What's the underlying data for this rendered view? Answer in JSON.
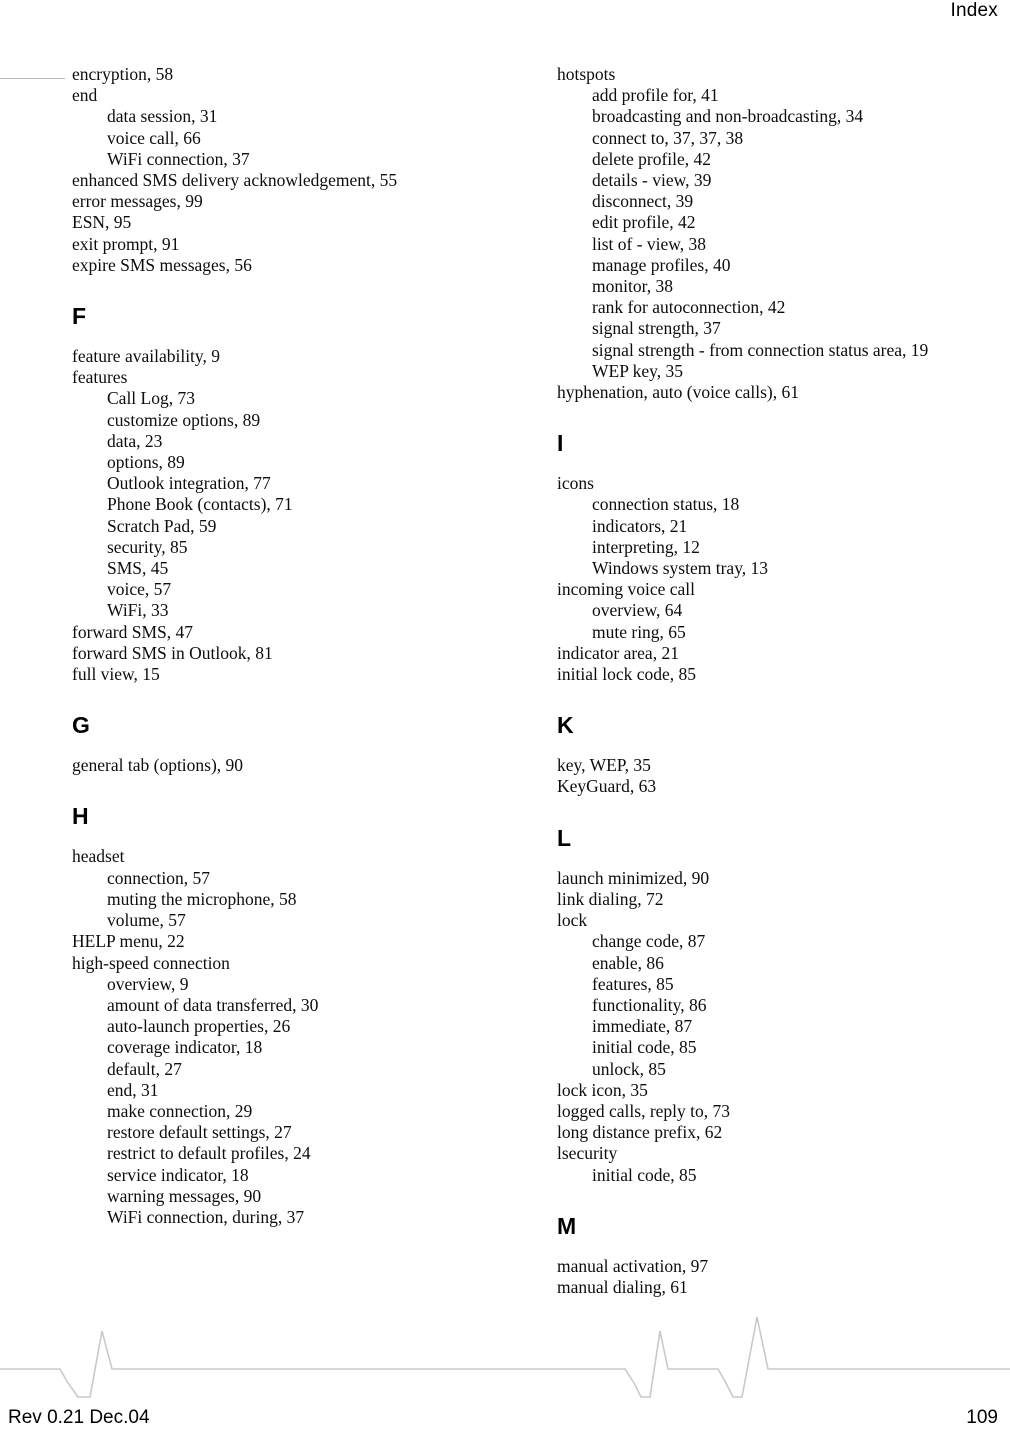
{
  "header": {
    "title": "Index"
  },
  "footer": {
    "revision": "Rev 0.21 Dec.04",
    "page_number": "109",
    "wave_color": "#c9c9c9"
  },
  "columns": {
    "left": [
      {
        "letter": null,
        "entries": [
          {
            "text": "encryption,  58",
            "level": 0
          },
          {
            "text": "end",
            "level": 0
          },
          {
            "text": "data session,  31",
            "level": 1
          },
          {
            "text": "voice call,  66",
            "level": 1
          },
          {
            "text": "WiFi connection,  37",
            "level": 1
          },
          {
            "text": "enhanced SMS delivery acknowledgement,  55",
            "level": 0
          },
          {
            "text": "error messages,  99",
            "level": 0
          },
          {
            "text": "ESN,  95",
            "level": 0
          },
          {
            "text": "exit prompt,  91",
            "level": 0
          },
          {
            "text": "expire SMS messages,  56",
            "level": 0
          }
        ]
      },
      {
        "letter": "F",
        "entries": [
          {
            "text": "feature availability,  9",
            "level": 0
          },
          {
            "text": "features",
            "level": 0
          },
          {
            "text": "Call Log,  73",
            "level": 1
          },
          {
            "text": "customize options,  89",
            "level": 1
          },
          {
            "text": "data,  23",
            "level": 1
          },
          {
            "text": "options,  89",
            "level": 1
          },
          {
            "text": "Outlook integration,  77",
            "level": 1
          },
          {
            "text": "Phone Book (contacts),  71",
            "level": 1
          },
          {
            "text": "Scratch Pad,  59",
            "level": 1
          },
          {
            "text": "security,  85",
            "level": 1
          },
          {
            "text": "SMS,  45",
            "level": 1
          },
          {
            "text": "voice,  57",
            "level": 1
          },
          {
            "text": "WiFi,  33",
            "level": 1
          },
          {
            "text": "forward SMS,  47",
            "level": 0
          },
          {
            "text": "forward SMS in Outlook,  81",
            "level": 0
          },
          {
            "text": "full view,  15",
            "level": 0
          }
        ]
      },
      {
        "letter": "G",
        "entries": [
          {
            "text": "general tab (options),  90",
            "level": 0
          }
        ]
      },
      {
        "letter": "H",
        "entries": [
          {
            "text": "headset",
            "level": 0
          },
          {
            "text": "connection,  57",
            "level": 1
          },
          {
            "text": "muting the microphone,  58",
            "level": 1
          },
          {
            "text": "volume,  57",
            "level": 1
          },
          {
            "text": "HELP menu,  22",
            "level": 0
          },
          {
            "text": "high-speed connection",
            "level": 0
          },
          {
            "text": "overview,  9",
            "level": 1
          },
          {
            "text": "amount of data transferred,  30",
            "level": 1
          },
          {
            "text": "auto-launch properties,  26",
            "level": 1
          },
          {
            "text": "coverage indicator,  18",
            "level": 1
          },
          {
            "text": "default,  27",
            "level": 1
          },
          {
            "text": "end,  31",
            "level": 1
          },
          {
            "text": "make connection,  29",
            "level": 1
          },
          {
            "text": "restore default settings,  27",
            "level": 1
          },
          {
            "text": "restrict to default profiles,  24",
            "level": 1
          },
          {
            "text": "service indicator,  18",
            "level": 1
          },
          {
            "text": "warning messages,  90",
            "level": 1
          },
          {
            "text": "WiFi connection, during,  37",
            "level": 1
          }
        ]
      }
    ],
    "right": [
      {
        "letter": null,
        "entries": [
          {
            "text": "hotspots",
            "level": 0
          },
          {
            "text": "add profile for,  41",
            "level": 1
          },
          {
            "text": "broadcasting and non-broadcasting,  34",
            "level": 1
          },
          {
            "text": "connect to,  37,  37,  38",
            "level": 1
          },
          {
            "text": "delete profile,  42",
            "level": 1
          },
          {
            "text": "details - view,  39",
            "level": 1
          },
          {
            "text": "disconnect,  39",
            "level": 1
          },
          {
            "text": "edit profile,  42",
            "level": 1
          },
          {
            "text": "list of - view,  38",
            "level": 1
          },
          {
            "text": "manage profiles,  40",
            "level": 1
          },
          {
            "text": "monitor,  38",
            "level": 1
          },
          {
            "text": "rank for autoconnection,  42",
            "level": 1
          },
          {
            "text": "signal strength,  37",
            "level": 1
          },
          {
            "text": "signal strength - from connection status area,  19",
            "level": 1
          },
          {
            "text": "WEP key,  35",
            "level": 1
          },
          {
            "text": "hyphenation, auto (voice calls),  61",
            "level": 0
          }
        ]
      },
      {
        "letter": "I",
        "entries": [
          {
            "text": "icons",
            "level": 0
          },
          {
            "text": "connection status,  18",
            "level": 1
          },
          {
            "text": "indicators,  21",
            "level": 1
          },
          {
            "text": "interpreting,  12",
            "level": 1
          },
          {
            "text": "Windows system tray,  13",
            "level": 1
          },
          {
            "text": "incoming voice call",
            "level": 0
          },
          {
            "text": "overview,  64",
            "level": 1
          },
          {
            "text": "mute ring,  65",
            "level": 1
          },
          {
            "text": "indicator area,  21",
            "level": 0
          },
          {
            "text": "initial lock code,  85",
            "level": 0
          }
        ]
      },
      {
        "letter": "K",
        "entries": [
          {
            "text": "key, WEP,  35",
            "level": 0
          },
          {
            "text": "KeyGuard,  63",
            "level": 0
          }
        ]
      },
      {
        "letter": "L",
        "entries": [
          {
            "text": "launch minimized,  90",
            "level": 0
          },
          {
            "text": "link dialing,  72",
            "level": 0
          },
          {
            "text": "lock",
            "level": 0
          },
          {
            "text": "change code,  87",
            "level": 1
          },
          {
            "text": "enable,  86",
            "level": 1
          },
          {
            "text": "features,  85",
            "level": 1
          },
          {
            "text": "functionality,  86",
            "level": 1
          },
          {
            "text": "immediate,  87",
            "level": 1
          },
          {
            "text": "initial code,  85",
            "level": 1
          },
          {
            "text": "unlock,  85",
            "level": 1
          },
          {
            "text": "lock icon,  35",
            "level": 0
          },
          {
            "text": "logged calls, reply to,  73",
            "level": 0
          },
          {
            "text": "long distance prefix,  62",
            "level": 0
          },
          {
            "text": "lsecurity",
            "level": 0
          },
          {
            "text": "initial code,  85",
            "level": 1
          }
        ]
      },
      {
        "letter": "M",
        "entries": [
          {
            "text": "manual activation,  97",
            "level": 0
          },
          {
            "text": "manual dialing,  61",
            "level": 0
          }
        ]
      }
    ]
  }
}
